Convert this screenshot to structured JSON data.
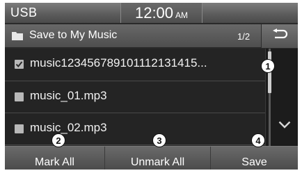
{
  "status": {
    "source": "USB",
    "time": "12:00",
    "ampm": "AM"
  },
  "header": {
    "title": "Save to My Music",
    "page": "1/2"
  },
  "list": {
    "items": [
      {
        "label": "music123456789101112131415...",
        "checked": true
      },
      {
        "label": "music_01.mp3",
        "checked": false
      },
      {
        "label": "music_02.mp3",
        "checked": false
      }
    ]
  },
  "buttons": {
    "mark_all": "Mark All",
    "unmark_all": "Unmark All",
    "save": "Save"
  },
  "callouts": [
    "1",
    "2",
    "3",
    "4"
  ],
  "icons": {
    "folder": "folder-icon",
    "back": "back-arrow-icon",
    "check": "checkmark-icon",
    "down": "chevron-down-icon"
  }
}
